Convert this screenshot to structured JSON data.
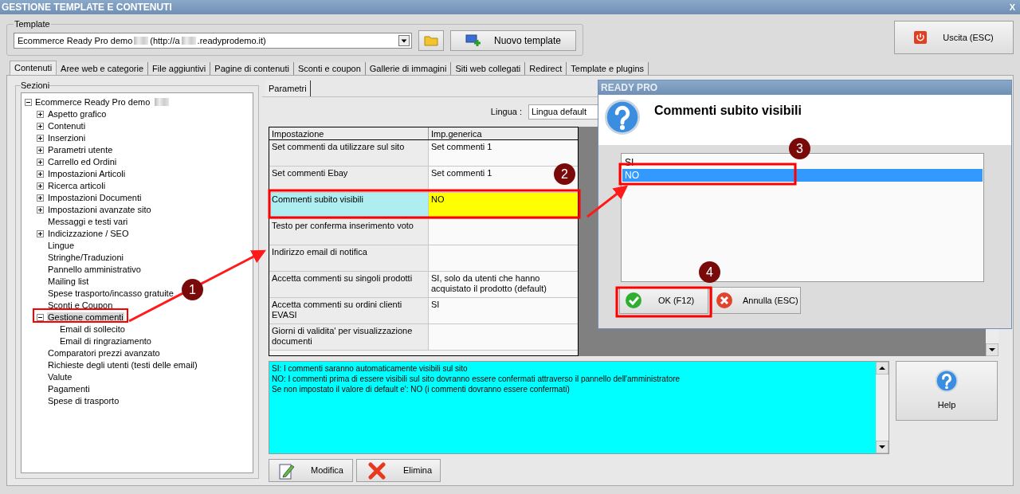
{
  "window": {
    "title": "GESTIONE TEMPLATE E CONTENUTI",
    "close": "X"
  },
  "template": {
    "legend": "Template",
    "value_parts": [
      "Ecommerce Ready Pro demo",
      "(http://a",
      ".readyprodemo.it)"
    ],
    "new_button": "Nuovo template"
  },
  "exit_button": "Uscita (ESC)",
  "tabs": [
    {
      "label": "Contenuti",
      "selected": true
    },
    {
      "label": "Aree web e categorie",
      "selected": false
    },
    {
      "label": "File aggiuntivi",
      "selected": false
    },
    {
      "label": "Pagine di contenuti",
      "selected": false
    },
    {
      "label": "Sconti e coupon",
      "selected": false
    },
    {
      "label": "Gallerie di immagini",
      "selected": false
    },
    {
      "label": "Siti web collegati",
      "selected": false
    },
    {
      "label": "Redirect",
      "selected": false
    },
    {
      "label": "Template e plugins",
      "selected": false
    }
  ],
  "sections": {
    "legend": "Sezioni",
    "tree": [
      {
        "label": "Ecommerce Ready Pro demo",
        "kind": "expanded",
        "selected": false,
        "children": [
          {
            "label": "Aspetto grafico",
            "kind": "collapsed",
            "selected": false
          },
          {
            "label": "Contenuti",
            "kind": "collapsed",
            "selected": false
          },
          {
            "label": "Inserzioni",
            "kind": "collapsed",
            "selected": false
          },
          {
            "label": "Parametri utente",
            "kind": "collapsed",
            "selected": false
          },
          {
            "label": "Carrello ed Ordini",
            "kind": "collapsed",
            "selected": false
          },
          {
            "label": "Impostazioni Articoli",
            "kind": "collapsed",
            "selected": false
          },
          {
            "label": "Ricerca articoli",
            "kind": "collapsed",
            "selected": false
          },
          {
            "label": "Impostazioni Documenti",
            "kind": "collapsed",
            "selected": false
          },
          {
            "label": "Impostazioni avanzate sito",
            "kind": "collapsed",
            "selected": false
          },
          {
            "label": "Messaggi e testi vari",
            "kind": "leaf",
            "selected": false
          },
          {
            "label": "Indicizzazione / SEO",
            "kind": "collapsed",
            "selected": false
          },
          {
            "label": "Lingue",
            "kind": "leaf",
            "selected": false
          },
          {
            "label": "Stringhe/Traduzioni",
            "kind": "leaf",
            "selected": false
          },
          {
            "label": "Pannello amministrativo",
            "kind": "leaf",
            "selected": false
          },
          {
            "label": "Mailing list",
            "kind": "leaf",
            "selected": false
          },
          {
            "label": "Spese trasporto/incasso gratuite",
            "kind": "leaf",
            "selected": false
          },
          {
            "label": "Sconti e Coupon",
            "kind": "leaf",
            "selected": false
          },
          {
            "label": "Gestione commenti",
            "kind": "expanded",
            "selected": true,
            "children": [
              {
                "label": "Email di sollecito",
                "kind": "leaf",
                "selected": false
              },
              {
                "label": "Email di ringraziamento",
                "kind": "leaf",
                "selected": false
              }
            ]
          },
          {
            "label": "Comparatori prezzi avanzato",
            "kind": "leaf",
            "selected": false
          },
          {
            "label": "Richieste degli utenti (testi delle email)",
            "kind": "leaf",
            "selected": false
          },
          {
            "label": "Valute",
            "kind": "leaf",
            "selected": false
          },
          {
            "label": "Pagamenti",
            "kind": "leaf",
            "selected": false
          },
          {
            "label": "Spese di trasporto",
            "kind": "leaf",
            "selected": false
          }
        ]
      }
    ]
  },
  "params": {
    "tab": "Parametri",
    "language_label": "Lingua :",
    "language_value": "Lingua default",
    "columns": [
      "Impostazione",
      "Imp.generica"
    ],
    "rows": [
      {
        "setting": "Set commenti da utilizzare sul sito",
        "value": "Set commenti 1",
        "selected": false
      },
      {
        "setting": "Set commenti Ebay",
        "value": "Set commenti 1",
        "selected": false
      },
      {
        "setting": "Commenti subito visibili",
        "value": "NO",
        "selected": true
      },
      {
        "setting": "Testo per conferma inserimento voto",
        "value": "",
        "selected": false
      },
      {
        "setting": "Indirizzo email di notifica",
        "value": "",
        "selected": false
      },
      {
        "setting": "Accetta commenti su singoli prodotti",
        "value": "SI, solo da utenti che hanno acquistato il prodotto (default)",
        "selected": false
      },
      {
        "setting": "Accetta commenti su ordini clienti EVASI",
        "value": "SI",
        "selected": false
      },
      {
        "setting": "Giorni di validita' per visualizzazione documenti",
        "value": "",
        "selected": false
      }
    ],
    "description": [
      "SI: I commenti saranno automaticamente visibili sul sito",
      "NO: I commenti prima di essere visibili sul sito dovranno essere confermati attraverso il pannello dell'amministratore",
      "Se non impostato il valore di default e': NO (i commenti dovranno essere confermati)"
    ],
    "buttons": [
      "Modifica",
      "Elimina"
    ]
  },
  "help_button": "Help",
  "dialog": {
    "title": "READY PRO",
    "heading": "Commenti subito visibili",
    "options": [
      {
        "label": "SI",
        "selected": false
      },
      {
        "label": "NO",
        "selected": true
      }
    ],
    "ok": "OK (F12)",
    "cancel": "Annulla (ESC)"
  },
  "annotations": [
    "1",
    "2",
    "3",
    "4"
  ]
}
